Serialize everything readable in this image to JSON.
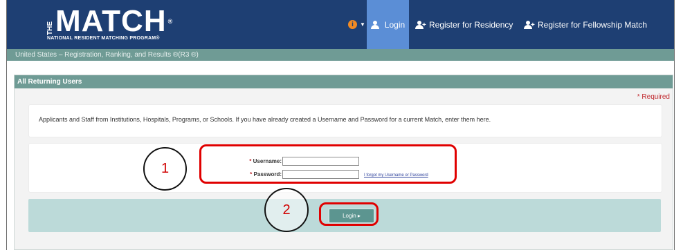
{
  "header": {
    "logo": {
      "the": "THE",
      "main": "MATCH",
      "reg": "®",
      "sub": "NATIONAL RESIDENT MATCHING PROGRAM®"
    },
    "nav": {
      "info_icon": "info-icon",
      "login": "Login",
      "register_residency": "Register for Residency",
      "register_fellowship": "Register for Fellowship Match"
    },
    "subtitle": "United States  –  Registration, Ranking, and Results ®(R3 ®)"
  },
  "panel": {
    "title": "All Returning Users",
    "required": "* Required",
    "instructions": "Applicants and Staff from Institutions, Hospitals, Programs, or Schools. If you have already created a Username and Password for a current Match, enter them here.",
    "username_label": "Username:",
    "password_label": "Password:",
    "required_star": "*",
    "username_value": "",
    "password_value": "",
    "forgot_link": "I forgot my Username or Password",
    "login_button": "Login ▸"
  },
  "annotations": {
    "step1": "1",
    "step2": "2",
    "highlight_color": "#e00000"
  },
  "colors": {
    "header_bg": "#1e3f73",
    "active_nav": "#5b8ed6",
    "teal": "#6f9b95",
    "light_teal": "#bcdad9"
  }
}
